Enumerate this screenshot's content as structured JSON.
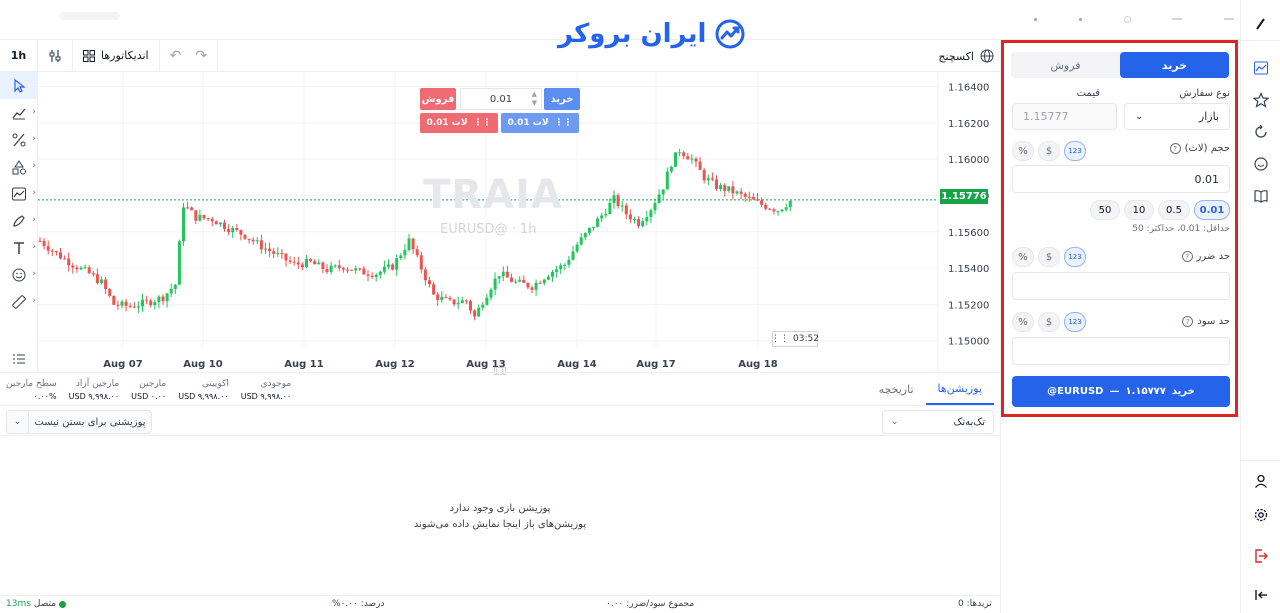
{
  "brand": {
    "name": "ایران بروکر",
    "color": "#2563eb"
  },
  "chart_toolbar": {
    "timeframe": "1h",
    "indicators_label": "اندیکاتورها",
    "exchange_label": "اکسچنج"
  },
  "left_tools": [
    "cursor-icon",
    "trend-line-icon",
    "percent-icon",
    "shapes-icon",
    "chart-icon",
    "brush-icon",
    "text-icon",
    "emoji-icon",
    "ruler-icon",
    "list-icon"
  ],
  "chart": {
    "watermark": "TRAIA",
    "symbol_label": "EURUSD@ · 1h",
    "last_price": "1.15776",
    "countdown": "03:52",
    "quick_trade": {
      "sell_label": "فروش",
      "buy_label": "خرید",
      "quantity": "0.01",
      "lot_sell": "لات 0.01",
      "lot_buy": "لات 0.01"
    }
  },
  "chart_data": {
    "type": "candlestick",
    "symbol": "EURUSD@",
    "timeframe": "1h",
    "x_tick_labels": [
      "Aug 07",
      "Aug 10",
      "Aug 11",
      "Aug 12",
      "Aug 13",
      "Aug 14",
      "Aug 17",
      "Aug 18"
    ],
    "y_tick_labels": [
      "1.16400",
      "1.16200",
      "1.16000",
      "1.15800",
      "1.15600",
      "1.15400",
      "1.15200",
      "1.15000"
    ],
    "ylim": [
      1.1496,
      1.1648
    ],
    "last_price": 1.15776,
    "close_path": [
      {
        "t": 0,
        "p": 1.1555
      },
      {
        "t": 4,
        "p": 1.1548
      },
      {
        "t": 8,
        "p": 1.1542
      },
      {
        "t": 12,
        "p": 1.1537
      },
      {
        "t": 15,
        "p": 1.1532
      },
      {
        "t": 18,
        "p": 1.152
      },
      {
        "t": 22,
        "p": 1.1519
      },
      {
        "t": 26,
        "p": 1.1521
      },
      {
        "t": 30,
        "p": 1.1524
      },
      {
        "t": 33,
        "p": 1.1531
      },
      {
        "t": 35,
        "p": 1.1575
      },
      {
        "t": 38,
        "p": 1.1568
      },
      {
        "t": 42,
        "p": 1.1567
      },
      {
        "t": 46,
        "p": 1.1562
      },
      {
        "t": 50,
        "p": 1.1558
      },
      {
        "t": 54,
        "p": 1.1552
      },
      {
        "t": 58,
        "p": 1.1547
      },
      {
        "t": 62,
        "p": 1.1542
      },
      {
        "t": 66,
        "p": 1.1543
      },
      {
        "t": 70,
        "p": 1.1539
      },
      {
        "t": 74,
        "p": 1.1541
      },
      {
        "t": 78,
        "p": 1.1538
      },
      {
        "t": 82,
        "p": 1.1537
      },
      {
        "t": 86,
        "p": 1.1541
      },
      {
        "t": 90,
        "p": 1.1555
      },
      {
        "t": 93,
        "p": 1.154
      },
      {
        "t": 96,
        "p": 1.1525
      },
      {
        "t": 100,
        "p": 1.1521
      },
      {
        "t": 104,
        "p": 1.1522
      },
      {
        "t": 106,
        "p": 1.1513
      },
      {
        "t": 108,
        "p": 1.1522
      },
      {
        "t": 110,
        "p": 1.153
      },
      {
        "t": 112,
        "p": 1.1537
      },
      {
        "t": 116,
        "p": 1.1532
      },
      {
        "t": 120,
        "p": 1.153
      },
      {
        "t": 124,
        "p": 1.1537
      },
      {
        "t": 128,
        "p": 1.1542
      },
      {
        "t": 131,
        "p": 1.1553
      },
      {
        "t": 134,
        "p": 1.1561
      },
      {
        "t": 137,
        "p": 1.1569
      },
      {
        "t": 140,
        "p": 1.1578
      },
      {
        "t": 143,
        "p": 1.157
      },
      {
        "t": 146,
        "p": 1.1565
      },
      {
        "t": 149,
        "p": 1.1573
      },
      {
        "t": 152,
        "p": 1.1585
      },
      {
        "t": 154,
        "p": 1.1598
      },
      {
        "t": 156,
        "p": 1.1605
      },
      {
        "t": 159,
        "p": 1.16
      },
      {
        "t": 162,
        "p": 1.159
      },
      {
        "t": 165,
        "p": 1.1585
      },
      {
        "t": 168,
        "p": 1.1583
      },
      {
        "t": 172,
        "p": 1.1579
      },
      {
        "t": 176,
        "p": 1.1575
      },
      {
        "t": 180,
        "p": 1.1572
      },
      {
        "t": 183,
        "p": 1.1577
      }
    ]
  },
  "bottom": {
    "stats": [
      {
        "label": "سطح مارجین",
        "value": "۰.۰۰%"
      },
      {
        "label": "مارجین آزاد",
        "value": "USD ۹,۹۹۸.۰۰"
      },
      {
        "label": "مارجین",
        "value": "USD ۰.۰۰"
      },
      {
        "label": "اکوییتی",
        "value": "USD ۹,۹۹۸.۰۰"
      },
      {
        "label": "موجودی",
        "value": "USD ۹,۹۹۸.۰۰"
      }
    ],
    "tabs": [
      "پوزیشن‌ها",
      "تاریخچه"
    ],
    "filter_value": "تک‌به‌تک",
    "close_label": "پوزیشنی برای بستن نیست",
    "empty_title": "پوزیشن بازی وجود ندارد",
    "empty_subtitle": "پوزیشن‌های باز اینجا نمایش داده می‌شوند"
  },
  "status_bar": {
    "trades": "تریدها: 0",
    "total_pl": "مجموع سود/ضرر: ۰.۰۰",
    "percent": "درصد: ۰.۰۰%",
    "connection": "متصل",
    "latency": "13ms"
  },
  "order_panel": {
    "tab_buy": "خرید",
    "tab_sell": "فروش",
    "order_type_label": "نوع سفارش",
    "order_type_value": "بازار",
    "price_label": "قیمت",
    "price_value": "1.15777",
    "volume_label": "حجم (لات)",
    "volume_value": "0.01",
    "mode_percent": "%",
    "mode_dollar": "$",
    "mode_number": "123",
    "presets": [
      "0.01",
      "0.5",
      "10",
      "50"
    ],
    "limits_text": "حداقل: 0.01، حداکثر: 50",
    "stop_loss_label": "حد ضرر",
    "take_profit_label": "حد سود",
    "submit_label": "خرید",
    "submit_price": "۱.۱۵۷۷۷",
    "submit_symbol": "EURUSD@",
    "highlight_color": "#dc2626"
  }
}
